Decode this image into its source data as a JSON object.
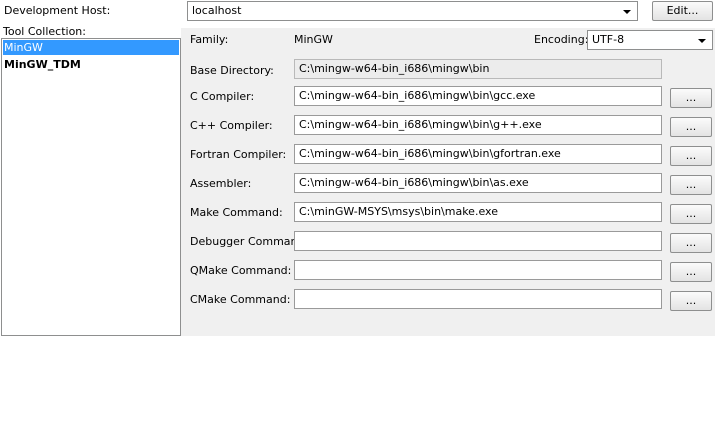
{
  "header": {
    "dev_host_label": "Development Host:",
    "dev_host_value": "localhost",
    "edit_button": "Edit..."
  },
  "tool_collection": {
    "label": "Tool Collection:",
    "items": [
      {
        "label": "MinGW",
        "selected": true
      },
      {
        "label": "MinGW_TDM",
        "selected": false
      }
    ]
  },
  "details": {
    "family_label": "Family:",
    "family_value": "MinGW",
    "encoding_label": "Encoding:",
    "encoding_value": "UTF-8",
    "base_dir_label": "Base Directory:",
    "base_dir_value": "C:\\mingw-w64-bin_i686\\mingw\\bin",
    "browse_label": "...",
    "rows": [
      {
        "label": "C Compiler:",
        "value": "C:\\mingw-w64-bin_i686\\mingw\\bin\\gcc.exe"
      },
      {
        "label": "C++ Compiler:",
        "value": "C:\\mingw-w64-bin_i686\\mingw\\bin\\g++.exe"
      },
      {
        "label": "Fortran Compiler:",
        "value": "C:\\mingw-w64-bin_i686\\mingw\\bin\\gfortran.exe"
      },
      {
        "label": "Assembler:",
        "value": "C:\\mingw-w64-bin_i686\\mingw\\bin\\as.exe"
      },
      {
        "label": "Make Command:",
        "value": "C:\\minGW-MSYS\\msys\\bin\\make.exe"
      },
      {
        "label": "Debugger Command:",
        "value": ""
      },
      {
        "label": "QMake Command:",
        "value": ""
      },
      {
        "label": "CMake Command:",
        "value": ""
      }
    ]
  }
}
